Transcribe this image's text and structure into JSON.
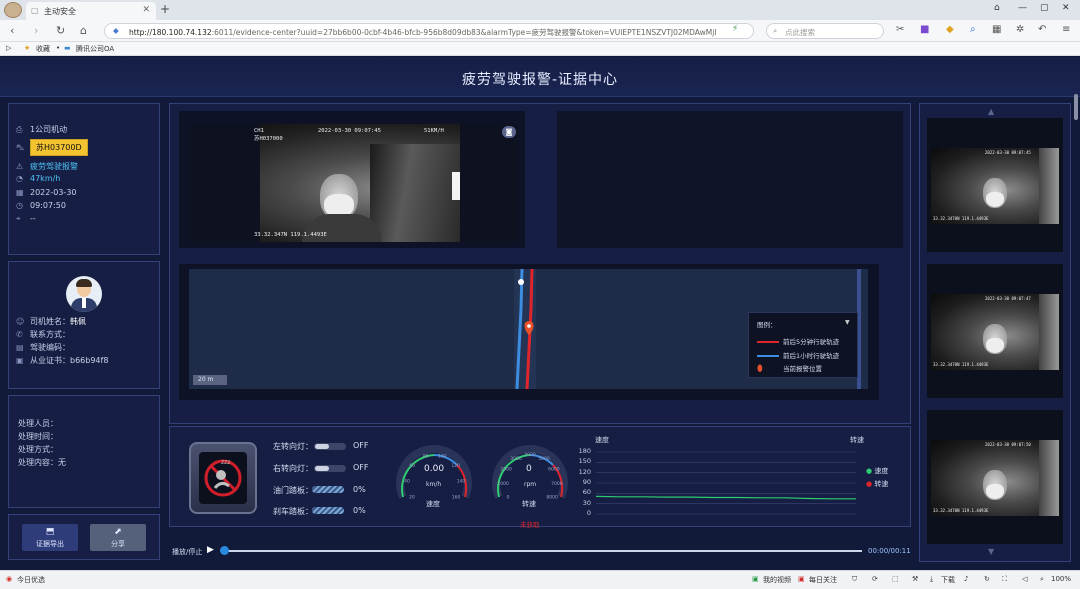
{
  "browser": {
    "tab_title": "主动安全",
    "url_host": "http://180.100.74.132",
    "url_path": ":6011/evidence-center?uuid=27bb6b00-0cbf-4b46-bfcb-956b8d09db83&alarmType=疲劳驾驶报警&token=VUlEPTE1NSZVTJ02MDAwMjI",
    "search_placeholder": "点此搜索",
    "bookmarks": [
      "收藏",
      "腾讯公司OA"
    ]
  },
  "app": {
    "title": "疲劳驾驶报警-证据中心"
  },
  "vehicle": {
    "company": "1公司机动",
    "plate": "苏H03700D",
    "alarm_type": "疲劳驾驶报警",
    "speed": "47km/h",
    "date": "2022-03-30",
    "time": "09:07:50",
    "location": "--"
  },
  "driver": {
    "name_label": "司机姓名：",
    "name": "韩佩",
    "contact_label": "联系方式：",
    "contact": "",
    "id_label": "驾驶编码：",
    "id": "",
    "cert_label": "从业证书：",
    "cert": "b66b94f8"
  },
  "handling": {
    "person_label": "处理人员：",
    "time_label": "处理时间：",
    "method_label": "处理方式：",
    "content_label": "处理内容：",
    "content": "无"
  },
  "buttons": {
    "export": "证据导出",
    "share": "分享"
  },
  "video": {
    "channel": "CH1",
    "plate_overlay": "苏H037000",
    "timestamp": "2022-03-30 09:07:45",
    "speed_overlay": "51KM/H",
    "coords": "33.32.347N 119.1.4493E"
  },
  "map": {
    "scale": "20 m",
    "legend_title": "图例：",
    "legend": [
      {
        "label": "前后5分钟行驶轨迹",
        "color": "#e0242b"
      },
      {
        "label": "前后1小时行驶轨迹",
        "color": "#3d8de0"
      },
      {
        "label": "当前报警位置",
        "color": "#e8502b"
      }
    ]
  },
  "status": {
    "left_turn_label": "左转向灯：",
    "left_turn": "OFF",
    "right_turn_label": "右转向灯：",
    "right_turn": "OFF",
    "throttle_label": "油门踏板：",
    "throttle": "0%",
    "brake_label": "刹车踏板：",
    "brake": "0%",
    "speed_value": "0.00",
    "speed_unit": "km/h",
    "speed_caption": "速度",
    "rpm_value": "0",
    "rpm_unit": "rpm",
    "rpm_caption": "转速",
    "not_obtained": "未获取",
    "speed_gauge_ticks": [
      "20",
      "40",
      "60",
      "80",
      "100",
      "120",
      "140",
      "160"
    ],
    "rpm_gauge_ticks": [
      "0",
      "1000",
      "2000",
      "3000",
      "4000",
      "5000",
      "6000",
      "7000",
      "8000"
    ]
  },
  "chart_data": {
    "type": "line",
    "title": "",
    "ylabel_left": "速度",
    "ylabel_right": "转速",
    "yticks": [
      0,
      30,
      60,
      90,
      120,
      150,
      180
    ],
    "ylim": [
      0,
      180
    ],
    "x": [
      0,
      1,
      2,
      3,
      4,
      5,
      6,
      7,
      8,
      9,
      10,
      11
    ],
    "series": [
      {
        "name": "速度",
        "color": "#2ecc71",
        "values": [
          51,
          50,
          50,
          49,
          49,
          48,
          48,
          47,
          47,
          45,
          44,
          44
        ]
      },
      {
        "name": "转速",
        "color": "#e0242b",
        "values": []
      }
    ],
    "legend": "right",
    "grid": true
  },
  "playback": {
    "label": "播放/停止",
    "time": "00:00/00:11",
    "progress": 0.0
  },
  "thumbnails": [
    {
      "timestamp": "2022-03-30 09:07:45",
      "coords": "33.32.3470N 119.1.4493E"
    },
    {
      "timestamp": "2022-03-30 09:07:47",
      "coords": "33.32.3470N 119.1.4493E"
    },
    {
      "timestamp": "2022-03-30 09:07:50",
      "coords": "33.32.3470N 119.1.4493E"
    }
  ],
  "statusbar": {
    "left": "今日优选",
    "items": [
      "我的视频",
      "每日关注"
    ],
    "download": "下载",
    "zoom": "100%"
  }
}
